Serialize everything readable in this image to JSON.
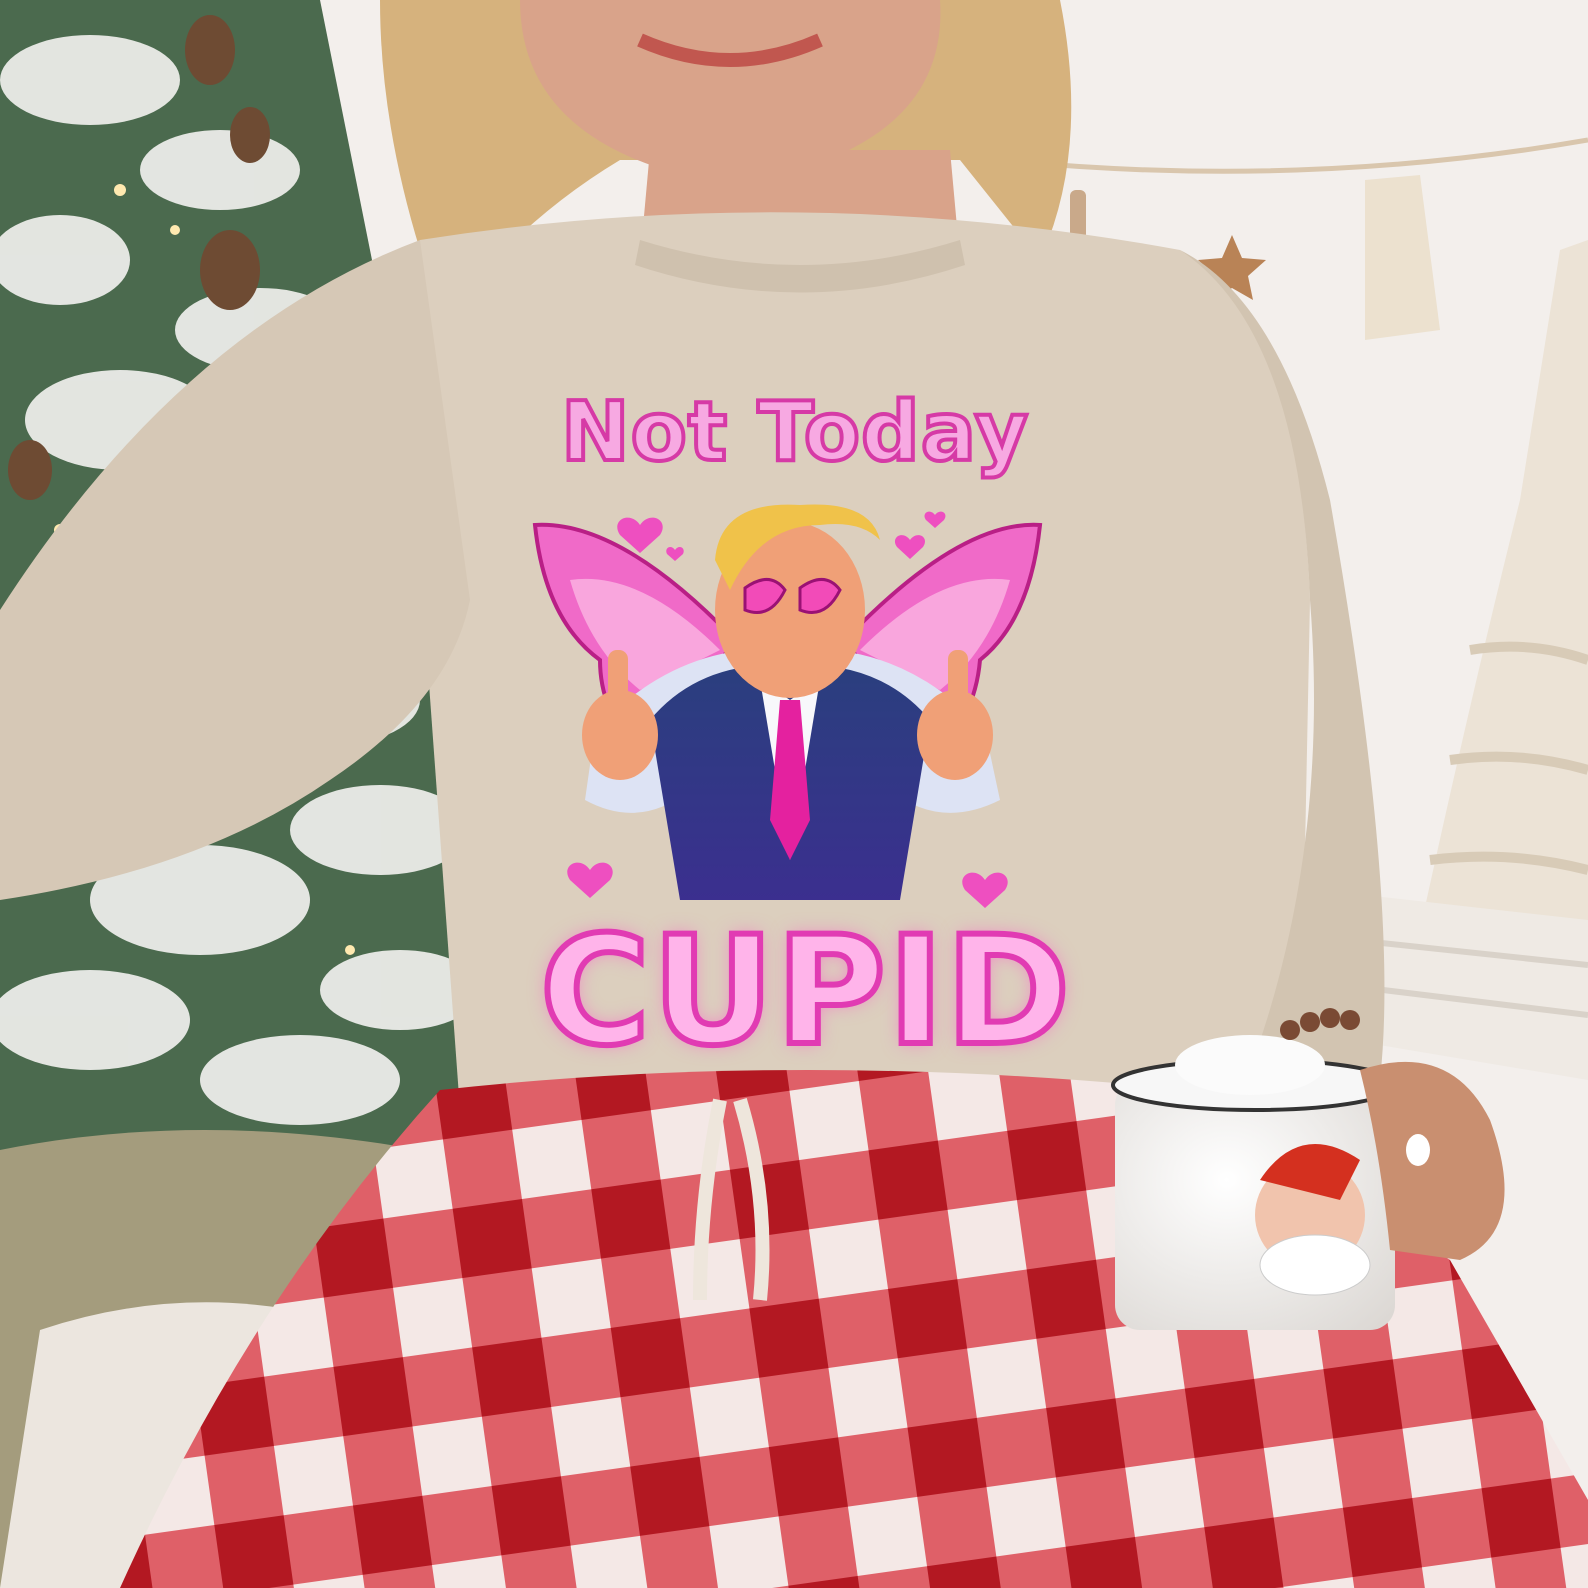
{
  "print": {
    "line1": "Not Today",
    "line2": "CUPID"
  },
  "colors": {
    "sweatshirt": "#dccfbe",
    "print_pink": "#e13bb3",
    "plaid_red": "#c8202c",
    "wall": "#f3efec",
    "tree_green": "#4b6a4e"
  }
}
